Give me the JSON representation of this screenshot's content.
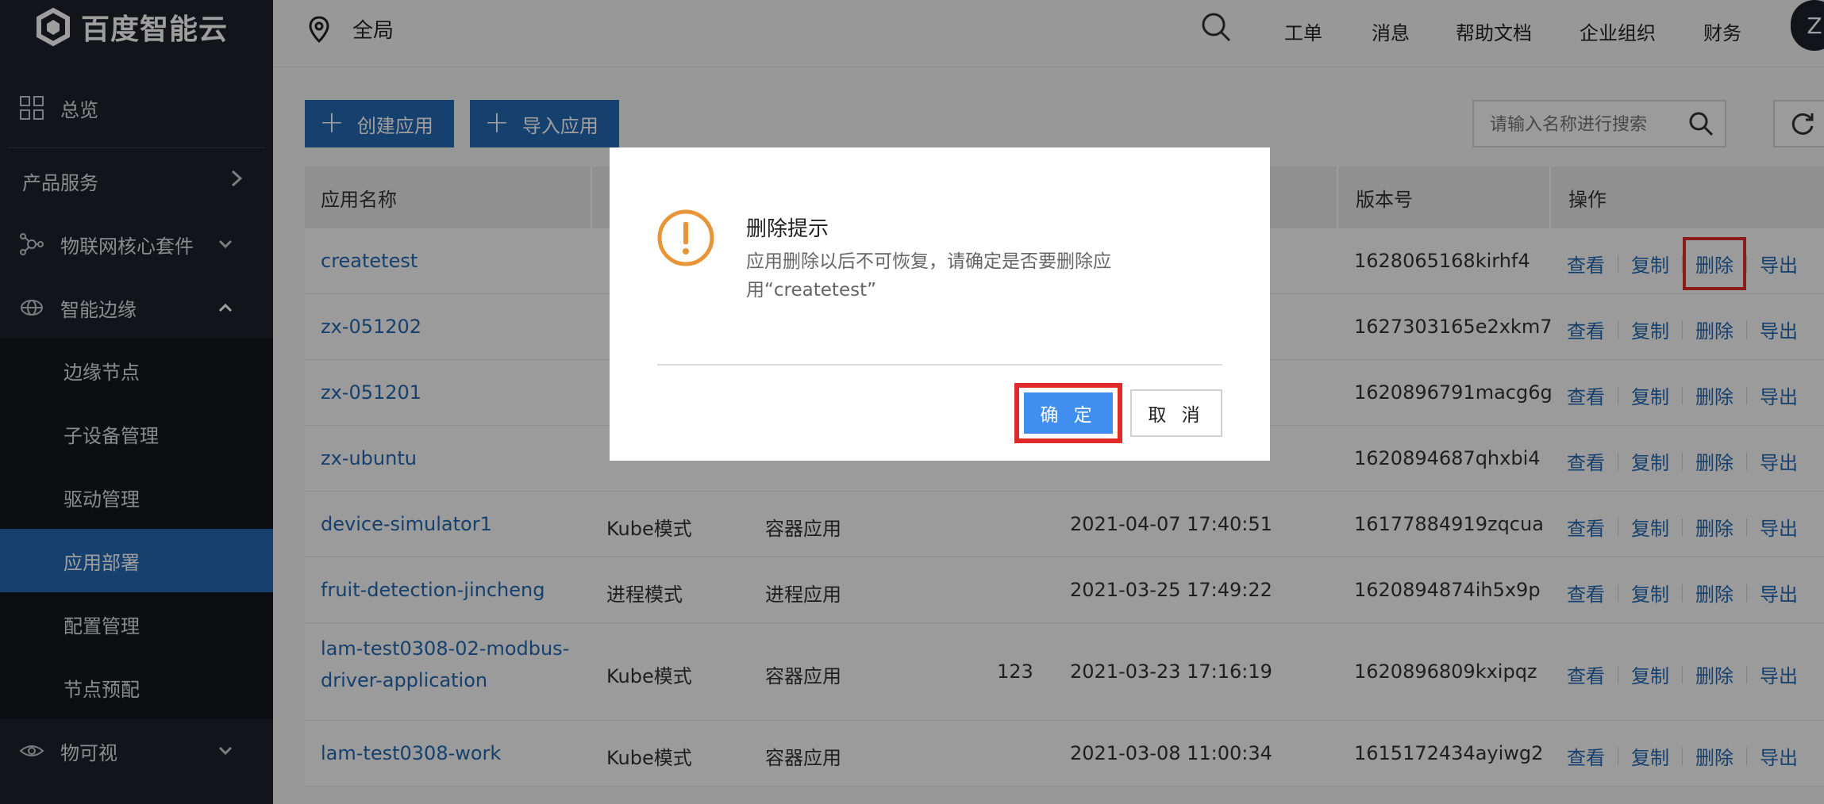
{
  "brand": {
    "name": "百度智能云"
  },
  "sidebar": {
    "items": [
      {
        "label": "总览"
      },
      {
        "label": "产品服务"
      },
      {
        "label": "物联网核心套件"
      },
      {
        "label": "智能边缘"
      },
      {
        "label": "边缘节点"
      },
      {
        "label": "子设备管理"
      },
      {
        "label": "驱动管理"
      },
      {
        "label": "应用部署"
      },
      {
        "label": "配置管理"
      },
      {
        "label": "节点预配"
      },
      {
        "label": "物可视"
      }
    ],
    "active_item": "应用部署"
  },
  "topbar": {
    "region": "全局",
    "links": [
      "工单",
      "消息",
      "帮助文档",
      "企业组织",
      "财务"
    ],
    "avatar_initial": "Z"
  },
  "toolbar": {
    "create_label": "创建应用",
    "import_label": "导入应用",
    "search_placeholder": "请输入名称进行搜索"
  },
  "table": {
    "headers": {
      "name": "应用名称",
      "version": "版本号",
      "ops": "操作"
    },
    "op_labels": [
      "查看",
      "复制",
      "删除",
      "导出"
    ],
    "rows": [
      {
        "name": "createtest",
        "mode": "",
        "type": "",
        "count": "",
        "time": "",
        "version": "1628065168kirhf4"
      },
      {
        "name": "zx-051202",
        "mode": "",
        "type": "",
        "count": "",
        "time": "",
        "version": "1627303165e2xkm7"
      },
      {
        "name": "zx-051201",
        "mode": "",
        "type": "",
        "count": "",
        "time": "",
        "version": "1620896791macg6g"
      },
      {
        "name": "zx-ubuntu",
        "mode": "",
        "type": "",
        "count": "",
        "time": "",
        "version": "1620894687qhxbi4"
      },
      {
        "name": "device-simulator1",
        "mode": "Kube模式",
        "type": "容器应用",
        "count": "",
        "time": "2021-04-07 17:40:51",
        "version": "16177884919zqcua"
      },
      {
        "name": "fruit-detection-jincheng",
        "mode": "进程模式",
        "type": "进程应用",
        "count": "",
        "time": "2021-03-25 17:49:22",
        "version": "1620894874ih5x9p"
      },
      {
        "name_line1": "lam-test0308-02-modbus-",
        "name_line2": "driver-application",
        "mode": "Kube模式",
        "type": "容器应用",
        "count": "123",
        "time": "2021-03-23 17:16:19",
        "version": "1620896809kxipqz"
      },
      {
        "name": "lam-test0308-work",
        "mode": "Kube模式",
        "type": "容器应用",
        "count": "",
        "time": "2021-03-08 11:00:34",
        "version": "1615172434ayiwg2"
      }
    ]
  },
  "dialog": {
    "title": "删除提示",
    "message": "应用删除以后不可恢复，请确定是否要删除应用“createtest”",
    "ok_label": "确 定",
    "cancel_label": "取 消",
    "warn_color": "#e8953a"
  }
}
